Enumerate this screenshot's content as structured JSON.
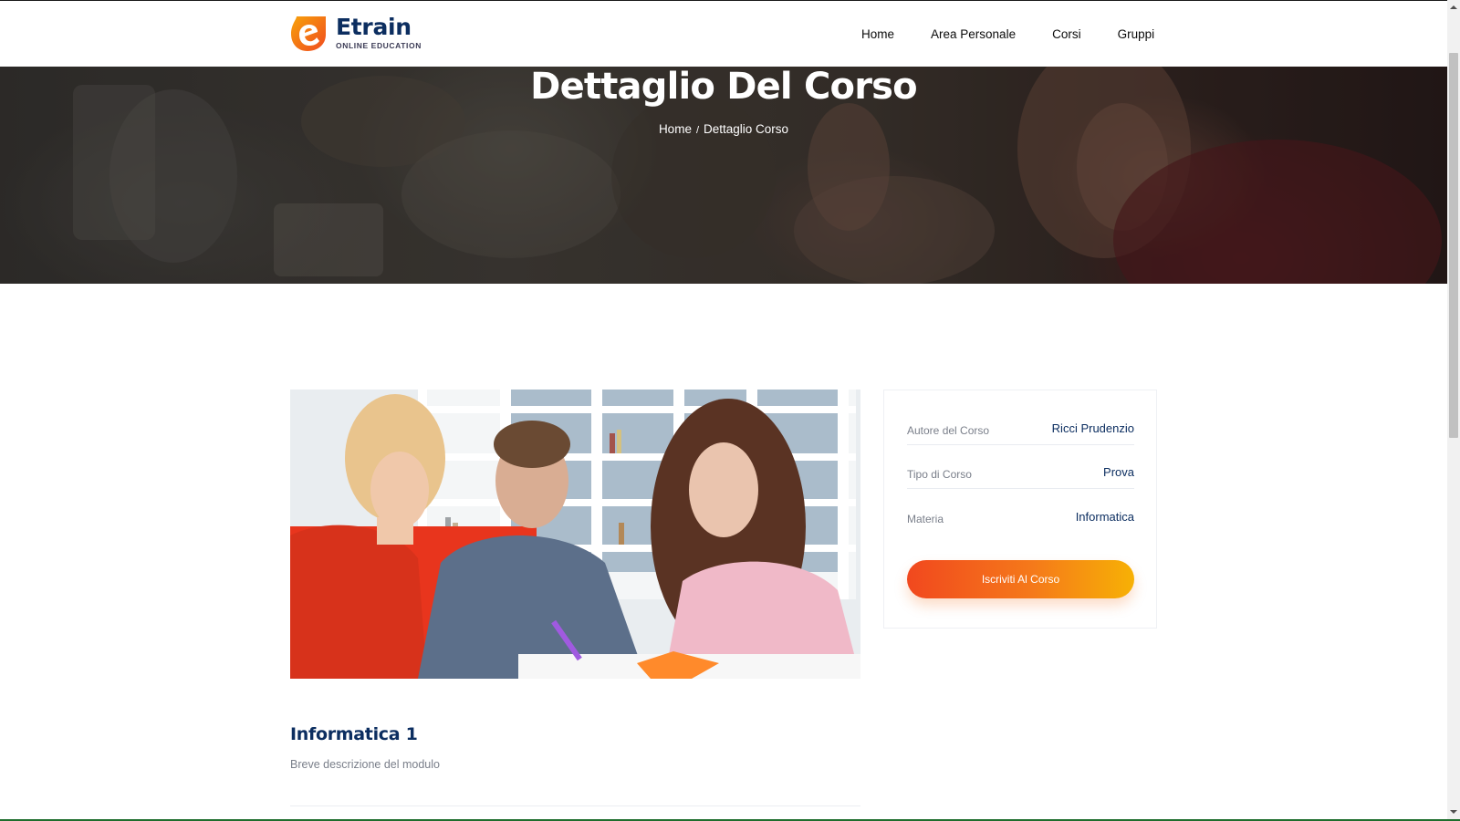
{
  "brand": {
    "name": "Etrain",
    "tagline": "ONLINE EDUCATION",
    "colors": {
      "navy": "#0c2e60",
      "orange": "#f1481e",
      "amber": "#f7b105"
    }
  },
  "nav": {
    "items": [
      {
        "label": "Home"
      },
      {
        "label": "Area Personale"
      },
      {
        "label": "Corsi"
      },
      {
        "label": "Gruppi"
      }
    ]
  },
  "banner": {
    "title": "Dettaglio Del Corso",
    "breadcrumb": {
      "home": "Home",
      "separator": "/",
      "current": "Dettaglio Corso"
    }
  },
  "course": {
    "image_icon": "students-studying-photo",
    "details": [
      {
        "label": "Autore del Corso",
        "value": "Ricci Prudenzio"
      },
      {
        "label": "Tipo di Corso",
        "value": "Prova"
      },
      {
        "label": "Materia",
        "value": "Informatica"
      }
    ],
    "enroll_label": "Iscriviti Al Corso"
  },
  "module": {
    "title": "Informatica 1",
    "description": "Breve descrizione del modulo"
  }
}
